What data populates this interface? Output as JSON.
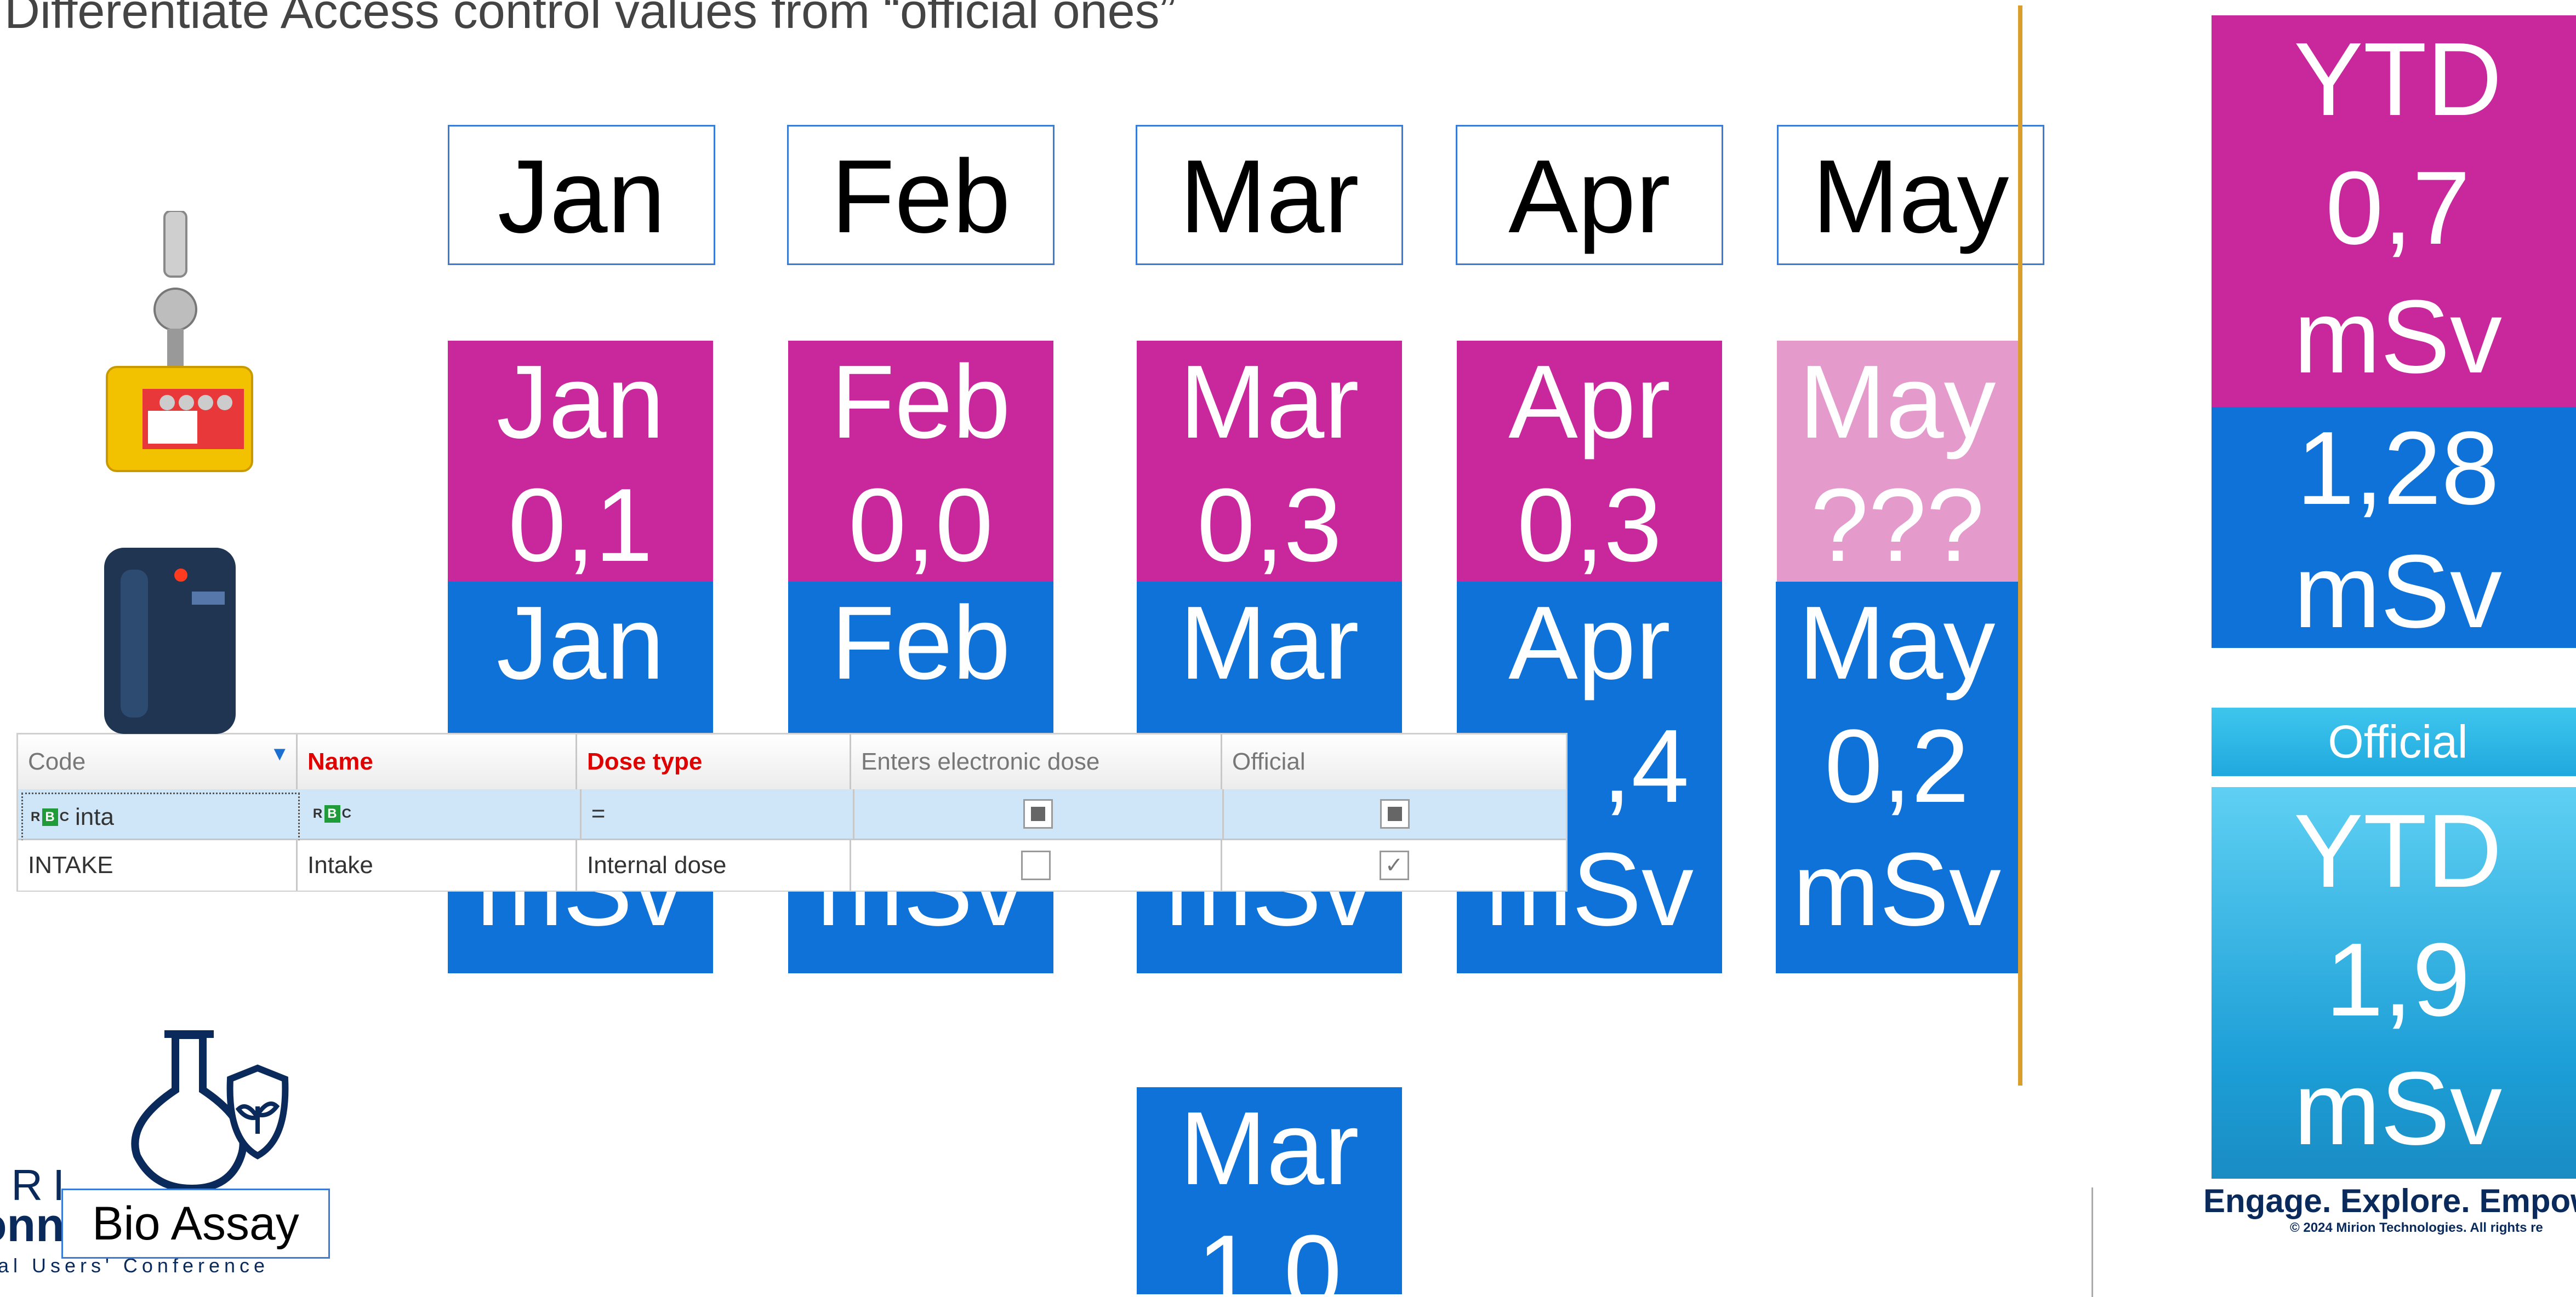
{
  "slide": {
    "title": "Differentiate Access control values from “official ones”",
    "tagline": "Engage. Explore. Empow",
    "copyright": "© 2024  Mirion Technologies. All rights re",
    "conference": {
      "logo_line1": "IRI",
      "logo_line2": "onn",
      "logo_line3": "al Users' Conference"
    },
    "bio_assay_label": "Bio Assay"
  },
  "month_headers": [
    "Jan",
    "Feb",
    "Mar",
    "Apr",
    "May"
  ],
  "access_tiles": [
    {
      "month": "Jan",
      "value": "0,1"
    },
    {
      "month": "Feb",
      "value": "0,0"
    },
    {
      "month": "Mar",
      "value": "0,3"
    },
    {
      "month": "Apr",
      "value": "0,3"
    },
    {
      "month": "May",
      "value": "???"
    }
  ],
  "electronic_tiles": [
    {
      "month": "Jan",
      "value": "",
      "unit": "mSv"
    },
    {
      "month": "Feb",
      "value": "",
      "unit": "mSv"
    },
    {
      "month": "Mar",
      "value": "",
      "unit": "mSv"
    },
    {
      "month": "Apr",
      "value": ",4",
      "unit": "mSv"
    },
    {
      "month": "May",
      "value": "0,2",
      "unit": "mSv"
    }
  ],
  "bio_tile": {
    "month": "Mar",
    "value": "1,0"
  },
  "ytd_access": {
    "label": "YTD",
    "value": "0,7",
    "unit": "mSv"
  },
  "ytd_electronic": {
    "value": "1,28",
    "unit": "mSv"
  },
  "official": {
    "label": "Official",
    "ytd_label": "YTD",
    "value": "1,9",
    "unit": "mSv"
  },
  "grid": {
    "columns": [
      "Code",
      "Name",
      "Dose type",
      "Enters electronic dose",
      "Official"
    ],
    "filter_row": {
      "code": "inta",
      "name": "",
      "dose_type": "="
    },
    "rows": [
      {
        "code": "INTAKE",
        "name": "Intake",
        "dose_type": "Internal dose",
        "enters_electronic": false,
        "official": true
      }
    ]
  },
  "colors": {
    "access": "#c8289c",
    "access_pending": "#e49acb",
    "electronic": "#0f72d9",
    "official": "#1fa8de",
    "divider": "#d99e2b"
  }
}
